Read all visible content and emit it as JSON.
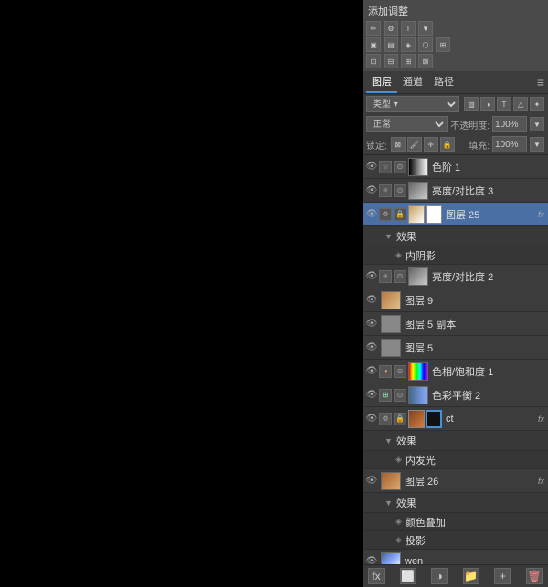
{
  "panel": {
    "title": "添加调整",
    "tabs": [
      "图层",
      "通道",
      "路径"
    ],
    "activeTab": "图层",
    "tabMenu": "≡",
    "blendMode": "正常",
    "opacity_label": "不透明度:",
    "opacity_value": "100%",
    "lock_label": "锁定:",
    "fill_label": "填充:",
    "fill_value": "100%",
    "search_placeholder": "类型 ▾"
  },
  "layers": [
    {
      "id": "layer-1",
      "visible": true,
      "type": "adjustment",
      "adj_type": "curves",
      "name": "色阶 1",
      "fx": false,
      "indent": 0,
      "thumb_type": "adjustment"
    },
    {
      "id": "layer-2",
      "visible": true,
      "type": "adjustment",
      "adj_type": "brightness",
      "name": "亮度/对比度 3",
      "fx": false,
      "indent": 0,
      "thumb_type": "adjustment"
    },
    {
      "id": "layer-3",
      "visible": true,
      "type": "normal",
      "name": "图层 25",
      "fx": true,
      "indent": 0,
      "thumb_type": "colored",
      "mask_type": "white",
      "has_effects": true,
      "effects": [
        "内阴影"
      ]
    },
    {
      "id": "layer-4",
      "visible": true,
      "type": "adjustment",
      "adj_type": "brightness",
      "name": "亮度/对比度 2",
      "fx": false,
      "indent": 0,
      "thumb_type": "adjustment"
    },
    {
      "id": "layer-5",
      "visible": true,
      "type": "normal",
      "name": "图层 9",
      "fx": false,
      "indent": 0,
      "thumb_type": "colored2"
    },
    {
      "id": "layer-6",
      "visible": true,
      "type": "normal",
      "name": "图层 5 副本",
      "fx": false,
      "indent": 0,
      "thumb_type": "gray"
    },
    {
      "id": "layer-7",
      "visible": true,
      "type": "normal",
      "name": "图层 5",
      "fx": false,
      "indent": 0,
      "thumb_type": "gray"
    },
    {
      "id": "layer-8",
      "visible": true,
      "type": "adjustment",
      "adj_type": "hue",
      "name": "色相/饱和度 1",
      "fx": false,
      "indent": 0,
      "thumb_type": "adjustment"
    },
    {
      "id": "layer-9",
      "visible": true,
      "type": "adjustment",
      "adj_type": "balance",
      "name": "色彩平衡 2",
      "fx": false,
      "indent": 0,
      "thumb_type": "adjustment"
    },
    {
      "id": "layer-10",
      "visible": true,
      "type": "normal",
      "name": "ct",
      "fx": true,
      "indent": 0,
      "thumb_type": "colored3",
      "mask_type": "black",
      "has_effects": true,
      "effects": [
        "内发光"
      ]
    },
    {
      "id": "layer-11",
      "visible": true,
      "type": "normal",
      "name": "图层 26",
      "fx": true,
      "indent": 0,
      "thumb_type": "colored4",
      "has_effects": true,
      "effects": [
        "颜色叠加",
        "投影"
      ]
    },
    {
      "id": "layer-12",
      "visible": true,
      "type": "normal",
      "name": "wen",
      "fx": false,
      "indent": 0,
      "thumb_type": "gradient_colored"
    }
  ],
  "bottom_buttons": [
    "fx",
    "mask",
    "adjustment",
    "group",
    "new",
    "delete"
  ]
}
